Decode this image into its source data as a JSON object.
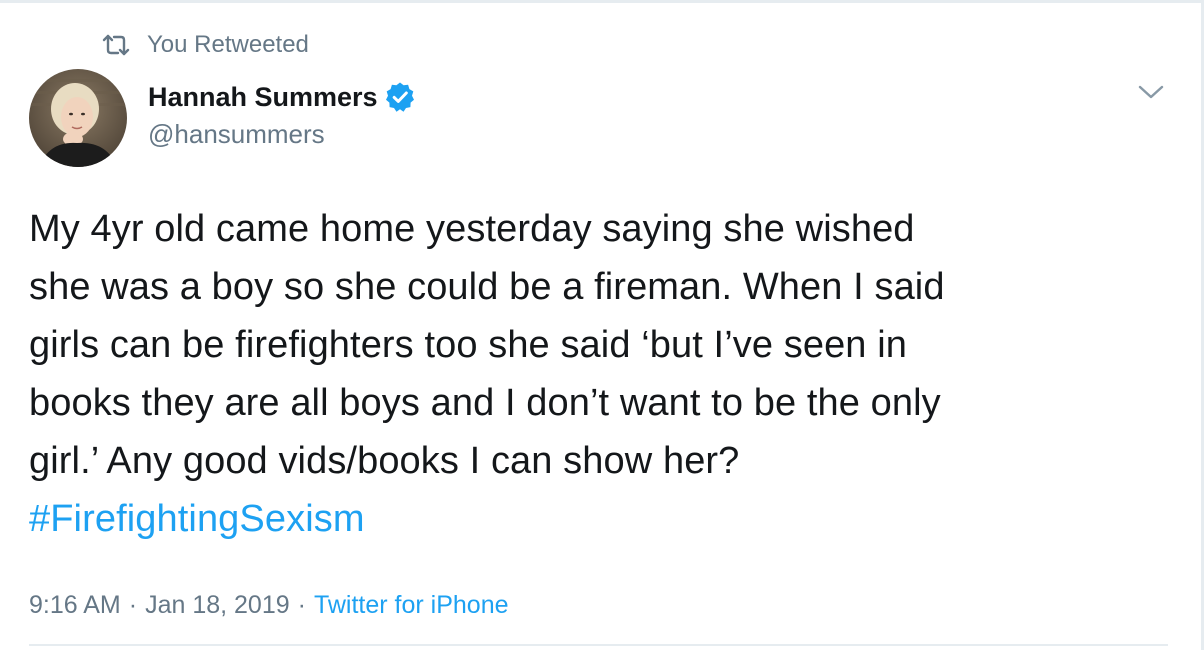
{
  "retweet": {
    "icon": "retweet-icon",
    "label": "You Retweeted"
  },
  "author": {
    "display_name": "Hannah Summers",
    "handle": "@hansummers",
    "verified": true,
    "verified_icon": "verified-badge-icon",
    "avatar_icon": "user-avatar"
  },
  "menu": {
    "icon": "chevron-down-icon"
  },
  "tweet": {
    "lines": [
      "My 4yr old came home yesterday saying she wished",
      "she was a boy so she could be a fireman. When I said",
      "girls can be firefighters too she said ‘but I’ve seen in",
      "books they are all boys and I don’t want to be the only",
      "girl.’ Any good vids/books I can show her?"
    ],
    "hashtag": "#FirefightingSexism"
  },
  "meta": {
    "time": "9:16 AM",
    "separator": "·",
    "date": "Jan 18, 2019",
    "source": "Twitter for iPhone"
  },
  "colors": {
    "text": "#14171a",
    "secondary": "#657786",
    "accent": "#1da1f2",
    "border": "#e6ecf0"
  }
}
